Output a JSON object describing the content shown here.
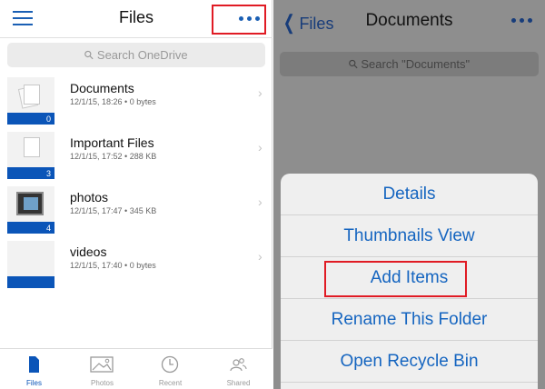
{
  "left_screen": {
    "title": "Files",
    "search_placeholder": "Search OneDrive",
    "files": [
      {
        "name": "Documents",
        "meta": "12/1/15, 18:26 • 0 bytes",
        "count": "0",
        "icon": "documents-thumb"
      },
      {
        "name": "Important Files",
        "meta": "12/1/15, 17:52 • 288 KB",
        "count": "3",
        "icon": "document-thumb"
      },
      {
        "name": "photos",
        "meta": "12/1/15, 17:47 • 345 KB",
        "count": "4",
        "icon": "photo-thumb"
      },
      {
        "name": "videos",
        "meta": "12/1/15, 17:40 • 0 bytes",
        "count": "",
        "icon": "empty-folder-thumb"
      }
    ],
    "tabs": [
      {
        "label": "Files",
        "icon": "file-icon",
        "active": true
      },
      {
        "label": "Photos",
        "icon": "image-icon",
        "active": false
      },
      {
        "label": "Recent",
        "icon": "clock-icon",
        "active": false
      },
      {
        "label": "Shared",
        "icon": "people-icon",
        "active": false
      }
    ]
  },
  "right_screen": {
    "back_label": "Files",
    "title": "Documents",
    "search_placeholder": "Search \"Documents\"",
    "actions": [
      "Details",
      "Thumbnails View",
      "Add Items",
      "Rename This Folder",
      "Open Recycle Bin"
    ]
  },
  "colors": {
    "accent": "#0b55b8",
    "highlight_box": "#e01b24",
    "action_text": "#1565c0"
  }
}
